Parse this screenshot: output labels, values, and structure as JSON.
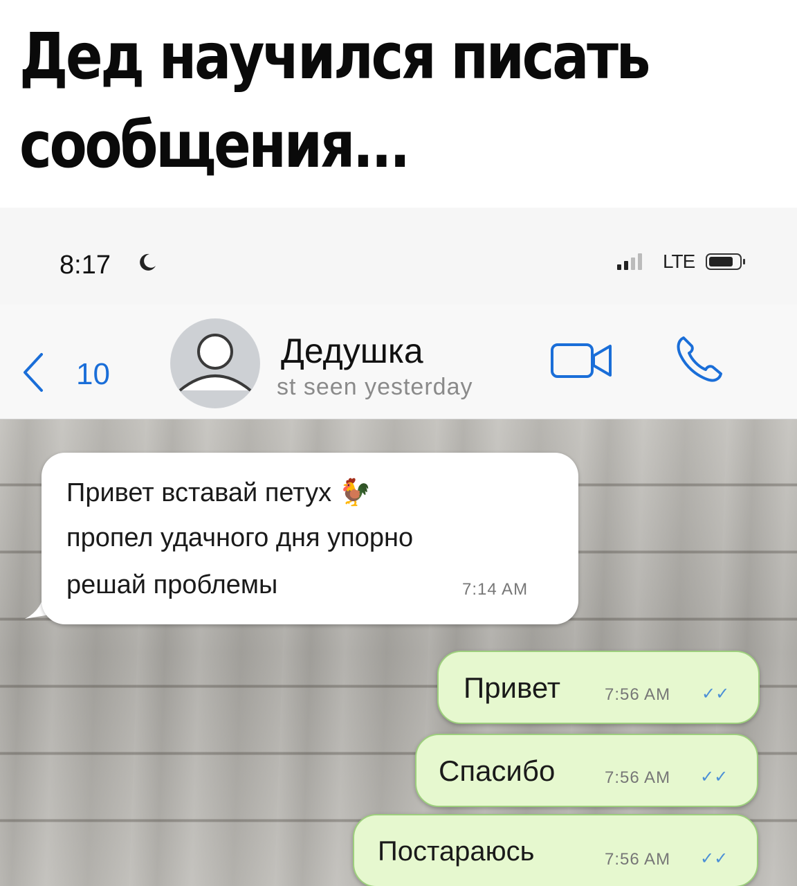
{
  "caption": {
    "line1": "Дед научился писать",
    "line2": "сообщения..."
  },
  "status_bar": {
    "time": "8:17",
    "network": "LTE"
  },
  "header": {
    "back_count": "10",
    "contact_name": "Дедушка",
    "contact_status": "st seen yesterday"
  },
  "messages": [
    {
      "direction": "incoming",
      "lines": [
        "Привет вставай петух 🐓",
        "пропел удачного дня упорно",
        "решай проблемы"
      ],
      "time": "7:14 AM"
    },
    {
      "direction": "outgoing",
      "text": "Привет",
      "time": "7:56 AM",
      "ticks": "✓✓"
    },
    {
      "direction": "outgoing",
      "text": "Спасибо",
      "time": "7:56 AM",
      "ticks": "✓✓"
    },
    {
      "direction": "outgoing",
      "text": "Постараюсь",
      "time": "7:56 AM",
      "ticks": "✓✓"
    }
  ],
  "colors": {
    "accent_blue": "#1a6ed8",
    "outgoing_bubble": "#e6f8cf",
    "incoming_bubble": "#ffffff",
    "read_ticks": "#4b8fd6"
  },
  "icons": {
    "back": "chevron-left-icon",
    "avatar": "person-silhouette-icon",
    "video": "video-camera-icon",
    "call": "phone-icon",
    "moon": "moon-icon"
  }
}
